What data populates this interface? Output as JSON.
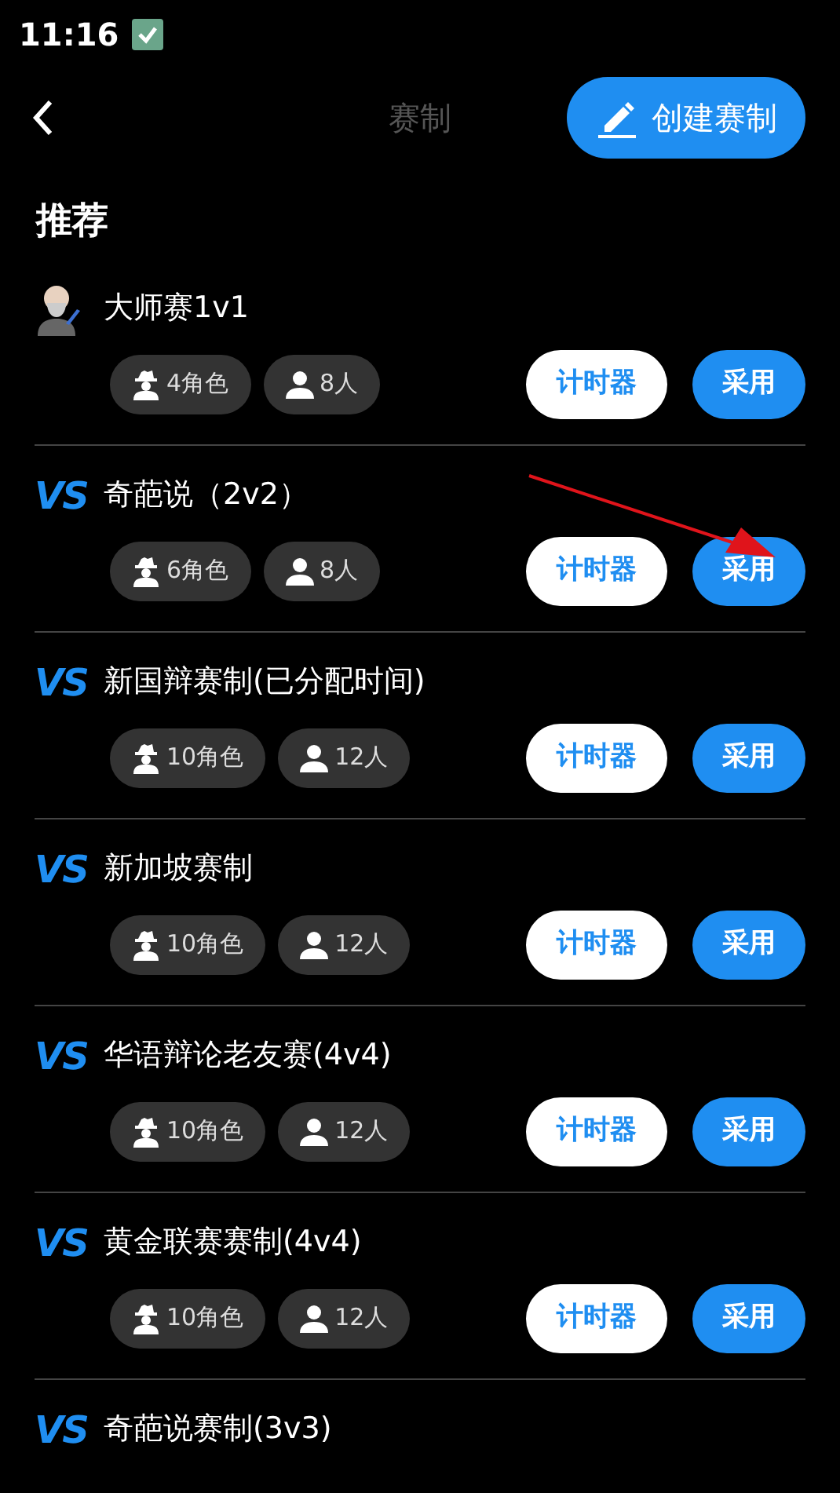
{
  "status_bar": {
    "time": "11:16"
  },
  "header": {
    "title": "赛制",
    "create_button": "创建赛制"
  },
  "section_title": "推荐",
  "formats": [
    {
      "kind": "avatar",
      "name": "大师赛1v1",
      "roles": "4角色",
      "people": "8人",
      "timer_button": "计时器",
      "use_button": "采用"
    },
    {
      "kind": "vs",
      "logo": "VS",
      "name": "奇葩说（2v2）",
      "roles": "6角色",
      "people": "8人",
      "timer_button": "计时器",
      "use_button": "采用",
      "annotated": true
    },
    {
      "kind": "vs",
      "logo": "VS",
      "name": "新国辩赛制(已分配时间)",
      "roles": "10角色",
      "people": "12人",
      "timer_button": "计时器",
      "use_button": "采用"
    },
    {
      "kind": "vs",
      "logo": "VS",
      "name": "新加坡赛制",
      "roles": "10角色",
      "people": "12人",
      "timer_button": "计时器",
      "use_button": "采用"
    },
    {
      "kind": "vs",
      "logo": "VS",
      "name": "华语辩论老友赛(4v4)",
      "roles": "10角色",
      "people": "12人",
      "timer_button": "计时器",
      "use_button": "采用"
    },
    {
      "kind": "vs",
      "logo": "VS",
      "name": "黄金联赛赛制(4v4)",
      "roles": "10角色",
      "people": "12人",
      "timer_button": "计时器",
      "use_button": "采用"
    },
    {
      "kind": "vs",
      "logo": "VS",
      "name": "奇葩说赛制(3v3)"
    }
  ]
}
